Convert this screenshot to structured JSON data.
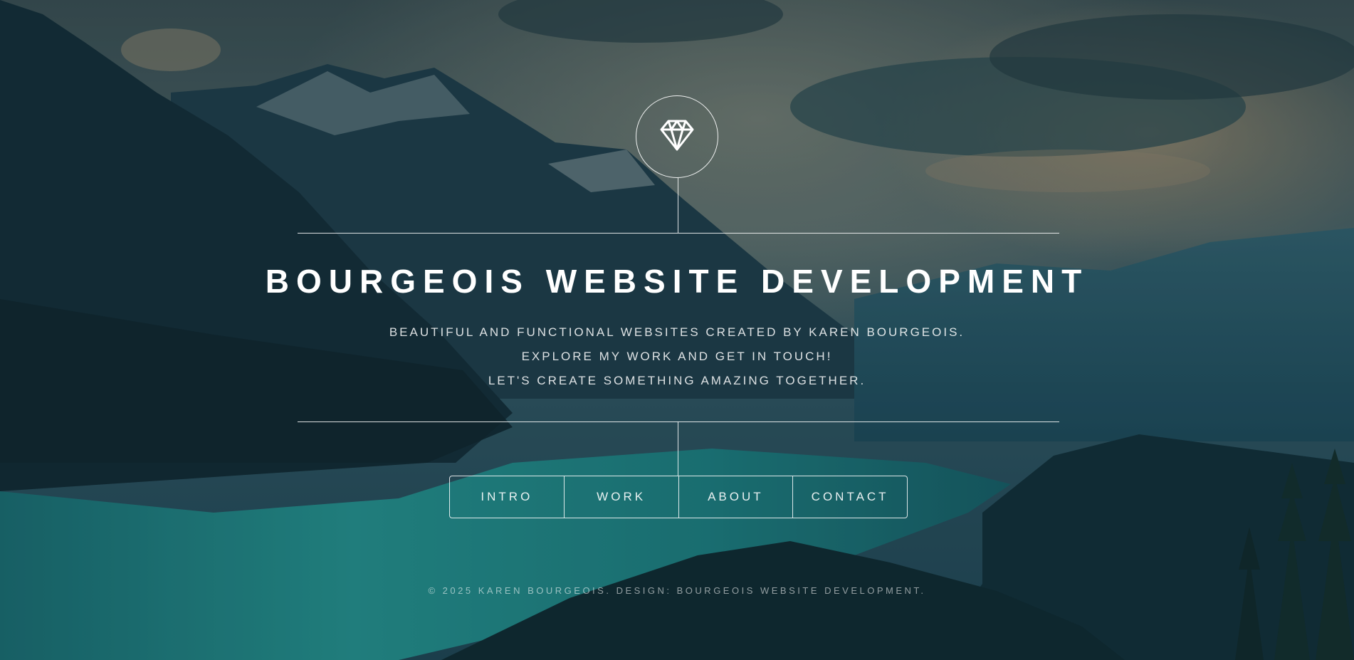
{
  "header": {
    "title": "BOURGEOIS WEBSITE DEVELOPMENT",
    "subtitle_lines": [
      "BEAUTIFUL AND FUNCTIONAL WEBSITES CREATED BY KAREN BOURGEOIS.",
      "EXPLORE MY WORK AND GET IN TOUCH!",
      "LET'S CREATE SOMETHING AMAZING TOGETHER."
    ],
    "logo_icon": "diamond-icon"
  },
  "nav": {
    "items": [
      {
        "label": "INTRO"
      },
      {
        "label": "WORK"
      },
      {
        "label": "ABOUT"
      },
      {
        "label": "CONTACT"
      }
    ]
  },
  "footer": {
    "text": "© 2025 KAREN BOURGEOIS. DESIGN: BOURGEOIS WEBSITE DEVELOPMENT."
  },
  "colors": {
    "sky": "#3e5a5e",
    "mountain": "#153340",
    "lake": "#1f8d8a",
    "text": "#ffffff"
  }
}
